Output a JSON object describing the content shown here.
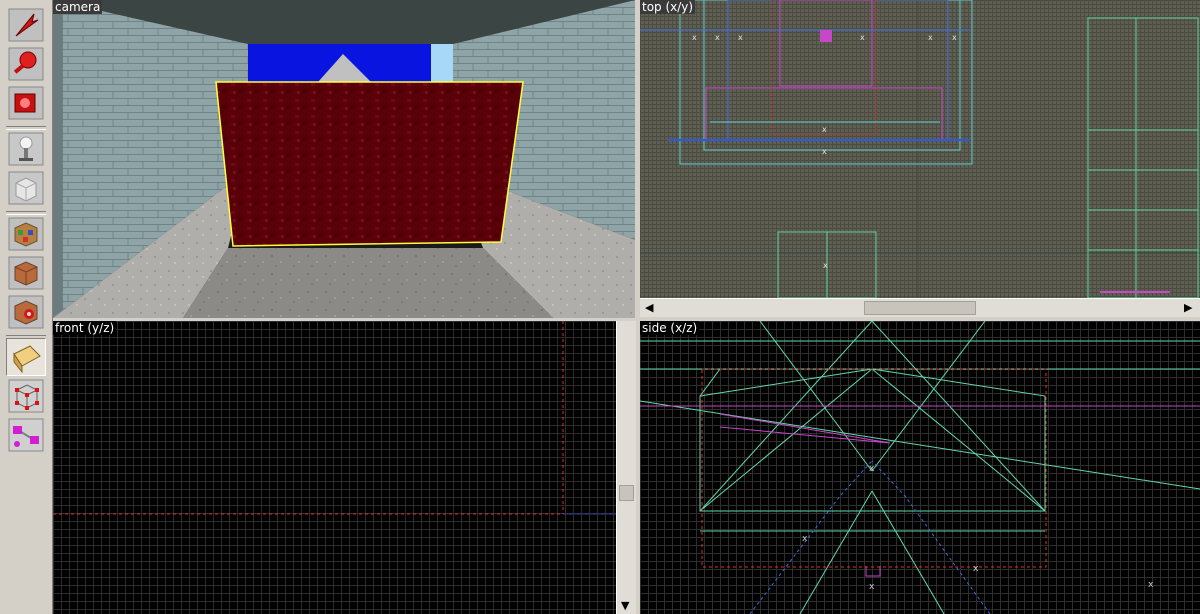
{
  "viewports": {
    "camera": {
      "label": "camera"
    },
    "top": {
      "label": "top (x/y)"
    },
    "front": {
      "label": "front (y/z)"
    },
    "side": {
      "label": "side (x/z)"
    }
  },
  "toolbar": {
    "tools": [
      {
        "name": "selection-tool-icon"
      },
      {
        "name": "magnify-tool-icon"
      },
      {
        "name": "camera-tool-icon"
      },
      {
        "name": "entity-tool-icon"
      },
      {
        "name": "block-tool-icon"
      },
      {
        "name": "texture-application-tool-icon"
      },
      {
        "name": "apply-current-texture-icon"
      },
      {
        "name": "apply-decal-icon"
      },
      {
        "name": "clipping-tool-icon"
      },
      {
        "name": "vertex-manipulation-tool-icon"
      },
      {
        "name": "path-tool-icon"
      }
    ]
  },
  "colors": {
    "selection": "#ff0000",
    "grid": "#2e2e2e",
    "brush_green": "#62d9a8",
    "brush_magenta": "#c846c8",
    "brush_blue": "#3c6ed8",
    "face_dark_red": "#5a0008"
  }
}
